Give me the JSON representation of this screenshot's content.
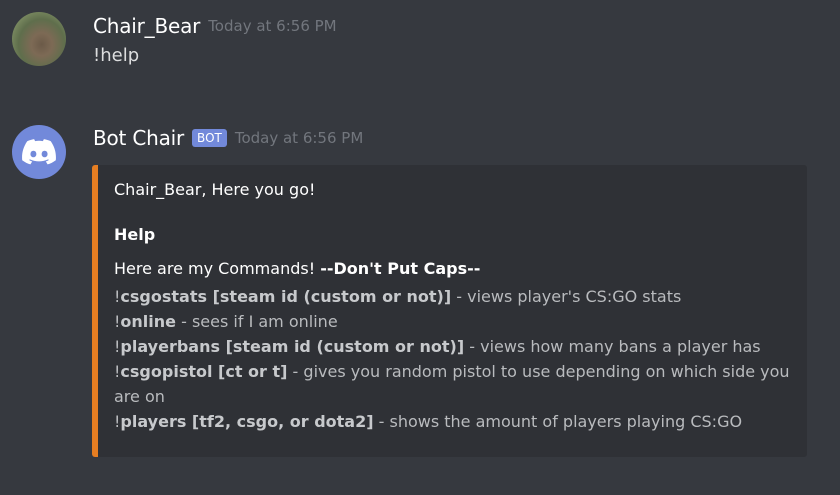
{
  "messages": [
    {
      "author": "Chair_Bear",
      "timestamp": "Today at 6:56 PM",
      "content": "!help",
      "avatar": "wombat-photo"
    },
    {
      "author": "Bot Chair",
      "bot_tag": "BOT",
      "timestamp": "Today at 6:56 PM",
      "avatar": "discord-logo-icon",
      "embed": {
        "accent_color": "#e67e22",
        "author_line": "Chair_Bear, Here you go!",
        "title": "Help",
        "description_lead": "Here are my Commands! ",
        "description_bold": "--Don't Put Caps--",
        "commands": [
          {
            "prefix": "!",
            "command": "csgostats [steam id (custom or not)]",
            "desc": " - views player's CS:GO stats"
          },
          {
            "prefix": "!",
            "command": "online",
            "desc": " - sees if I am online"
          },
          {
            "prefix": "!",
            "command": "playerbans [steam id (custom or not)]",
            "desc": " - views how many bans a player has"
          },
          {
            "prefix": "!",
            "command": "csgopistol [ct or t]",
            "desc": " - gives you random pistol to use depending on which side you are on"
          },
          {
            "prefix": "!",
            "command": "players [tf2, csgo, or dota2]",
            "desc": " - shows the amount of players playing CS:GO"
          }
        ]
      }
    }
  ],
  "colors": {
    "background": "#36393f",
    "embed_background": "#2f3136",
    "blurple": "#7289da",
    "timestamp": "#72767d"
  }
}
